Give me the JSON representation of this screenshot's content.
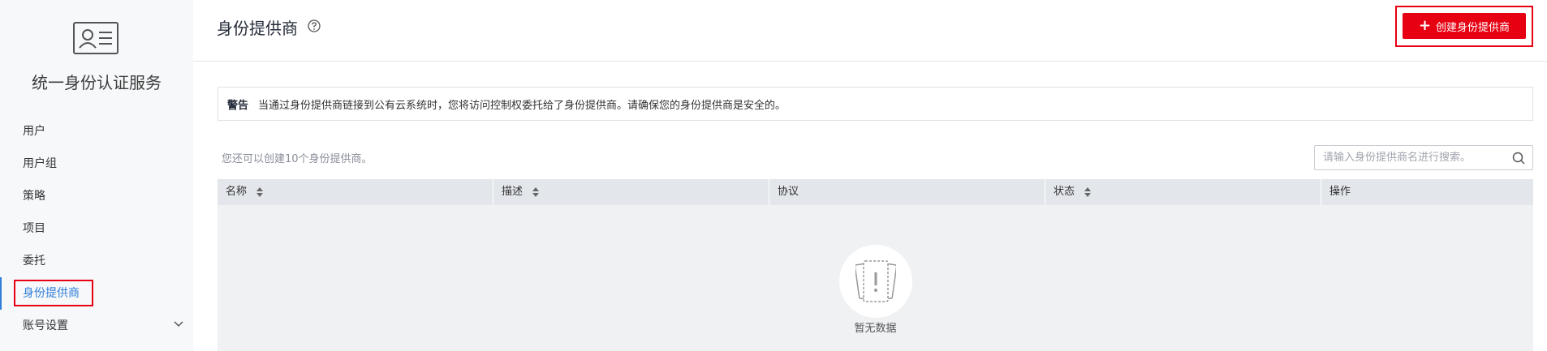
{
  "sidebar": {
    "service_title": "统一身份认证服务",
    "items": [
      {
        "label": "用户"
      },
      {
        "label": "用户组"
      },
      {
        "label": "策略"
      },
      {
        "label": "项目"
      },
      {
        "label": "委托"
      },
      {
        "label": "身份提供商",
        "active": true
      },
      {
        "label": "账号设置",
        "expandable": true
      }
    ]
  },
  "header": {
    "title": "身份提供商",
    "create_button_label": "创建身份提供商"
  },
  "warning": {
    "label": "警告",
    "text": "当通过身份提供商链接到公有云系统时，您将访问控制权委托给了身份提供商。请确保您的身份提供商是安全的。"
  },
  "quota_text": "您还可以创建10个身份提供商。",
  "search": {
    "placeholder": "请输入身份提供商名进行搜索。"
  },
  "table": {
    "columns": [
      {
        "label": "名称",
        "sortable": true
      },
      {
        "label": "描述",
        "sortable": true
      },
      {
        "label": "协议",
        "sortable": false
      },
      {
        "label": "状态",
        "sortable": true
      },
      {
        "label": "操作",
        "sortable": false
      }
    ],
    "empty_text": "暂无数据"
  },
  "colors": {
    "accent_red": "#e60012",
    "active_blue": "#2f7ed8"
  }
}
